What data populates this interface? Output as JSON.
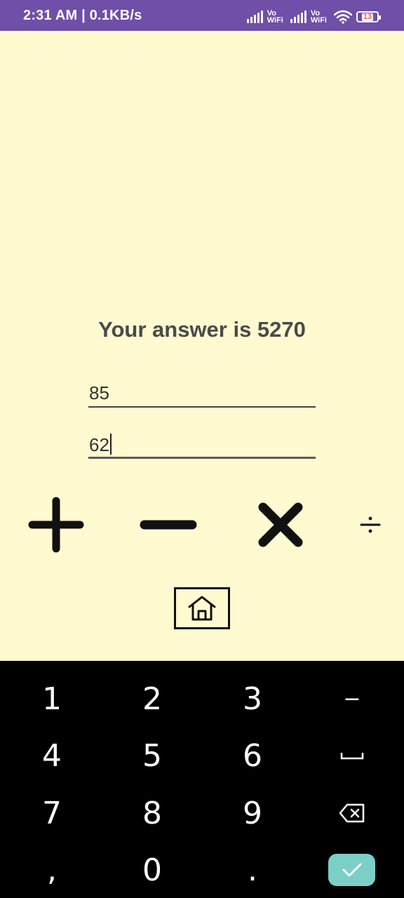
{
  "status_bar": {
    "time": "2:31 AM | 0.1KB/s",
    "vowifi_1": [
      "Vo",
      "WiFi"
    ],
    "vowifi_2": [
      "Vo",
      "WiFi"
    ],
    "battery": "13",
    "bg_color": "#6f4fa7"
  },
  "main": {
    "answer": "Your answer is 5270",
    "input1": {
      "value": "85"
    },
    "input2": {
      "value": "62"
    },
    "operators": [
      {
        "name": "plus",
        "icon": "plus-icon"
      },
      {
        "name": "minus",
        "icon": "minus-icon"
      },
      {
        "name": "multiply",
        "icon": "times-icon"
      },
      {
        "name": "divide",
        "icon": "divide-icon"
      }
    ],
    "home_icon": "home-icon",
    "bg_color": "#fffad0"
  },
  "keyboard": {
    "keys": [
      "1",
      "2",
      "3",
      "−",
      "4",
      "5",
      "6",
      "␣",
      "7",
      "8",
      "9",
      "backspace",
      ",",
      "0",
      ".",
      "enter"
    ],
    "enter_color": "#7ccfc6"
  }
}
